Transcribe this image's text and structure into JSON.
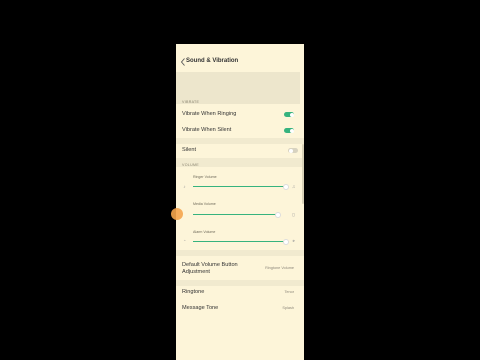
{
  "header": {
    "title": "Sound & Vibration"
  },
  "vibrate": {
    "section_label": "VIBRATE",
    "when_ringing": {
      "label": "Vibrate When Ringing",
      "on": true
    },
    "when_silent": {
      "label": "Vibrate When Silent",
      "on": true
    }
  },
  "silent": {
    "label": "Silent",
    "on": false
  },
  "volume": {
    "section_label": "VOLUME",
    "ringer": {
      "label": "Ringer Volume",
      "level": 0.95
    },
    "media": {
      "label": "Media Volume",
      "level": 0.9
    },
    "alarm": {
      "label": "Alarm Volume",
      "level": 0.95
    }
  },
  "default_volume": {
    "label_line1": "Default Volume Button",
    "label_line2": "Adjustment",
    "value": "Ringtone Volume"
  },
  "ringtone": {
    "label": "Ringtone",
    "value": "Tenor"
  },
  "message_tone": {
    "label": "Message Tone",
    "value": "Splash"
  },
  "colors": {
    "accent": "#36b37e",
    "background": "#fdf5d9",
    "touch_indicator": "#f5a54c"
  }
}
